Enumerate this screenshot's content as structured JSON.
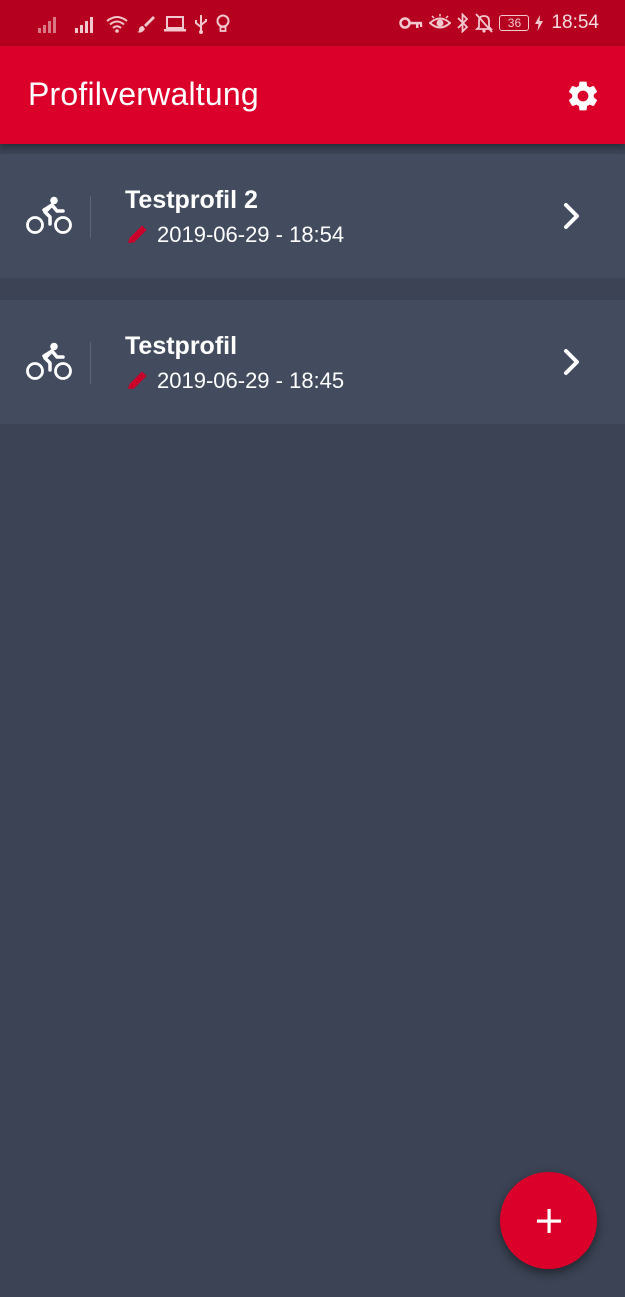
{
  "status_bar": {
    "time": "18:54",
    "battery_level": "36",
    "left_icons": [
      "signal-icon",
      "signal-icon",
      "wifi-icon",
      "brush-icon",
      "laptop-icon",
      "usb-icon",
      "bulb-icon"
    ],
    "right_icons": [
      "vpn-key-icon",
      "eye-icon",
      "bluetooth-icon",
      "bell-off-icon",
      "battery-icon",
      "charging-icon"
    ]
  },
  "app_bar": {
    "title": "Profilverwaltung",
    "settings_icon": "gear-icon"
  },
  "profiles": [
    {
      "name": "Testprofil 2",
      "date": "2019-06-29 - 18:54",
      "type_icon": "bicycle-icon"
    },
    {
      "name": "Testprofil",
      "date": "2019-06-29 - 18:45",
      "type_icon": "bicycle-icon"
    }
  ],
  "fab": {
    "icon": "plus-icon"
  },
  "colors": {
    "status_bar": "#b5001f",
    "app_bar": "#da0029",
    "background": "#3b4354",
    "card": "#424c5e",
    "accent": "#c8002a"
  }
}
